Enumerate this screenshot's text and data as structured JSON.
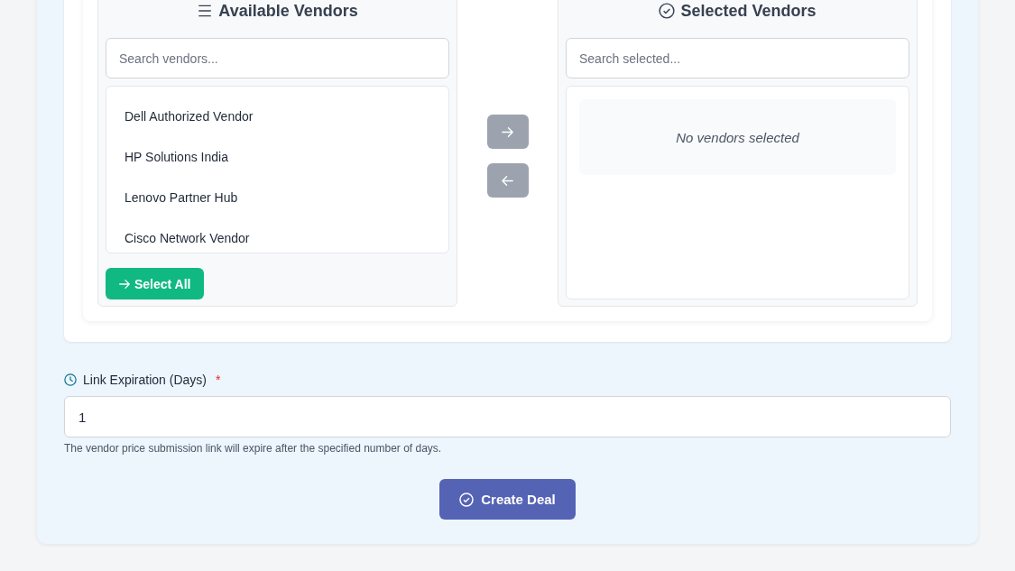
{
  "available": {
    "title": "Available Vendors",
    "search": {
      "placeholder": "Search vendors..."
    },
    "vendors": [
      {
        "name": "Dell Authorized Vendor"
      },
      {
        "name": "HP Solutions India"
      },
      {
        "name": "Lenovo Partner Hub"
      },
      {
        "name": "Cisco Network Vendor"
      }
    ],
    "select_all": "Select All"
  },
  "transfer_buttons": [
    {
      "kind": "right",
      "disabled": true
    },
    {
      "kind": "left",
      "disabled": true
    }
  ],
  "selected": {
    "title": "Selected Vendors",
    "search": {
      "placeholder": "Search selected..."
    },
    "empty_message": "No vendors selected"
  },
  "expiration": {
    "label": "Link Expiration (Days)",
    "required_mark": "*",
    "value": "1",
    "help": "The vendor price submission link will expire after the specified number of days."
  },
  "submit": "Create Deal"
}
